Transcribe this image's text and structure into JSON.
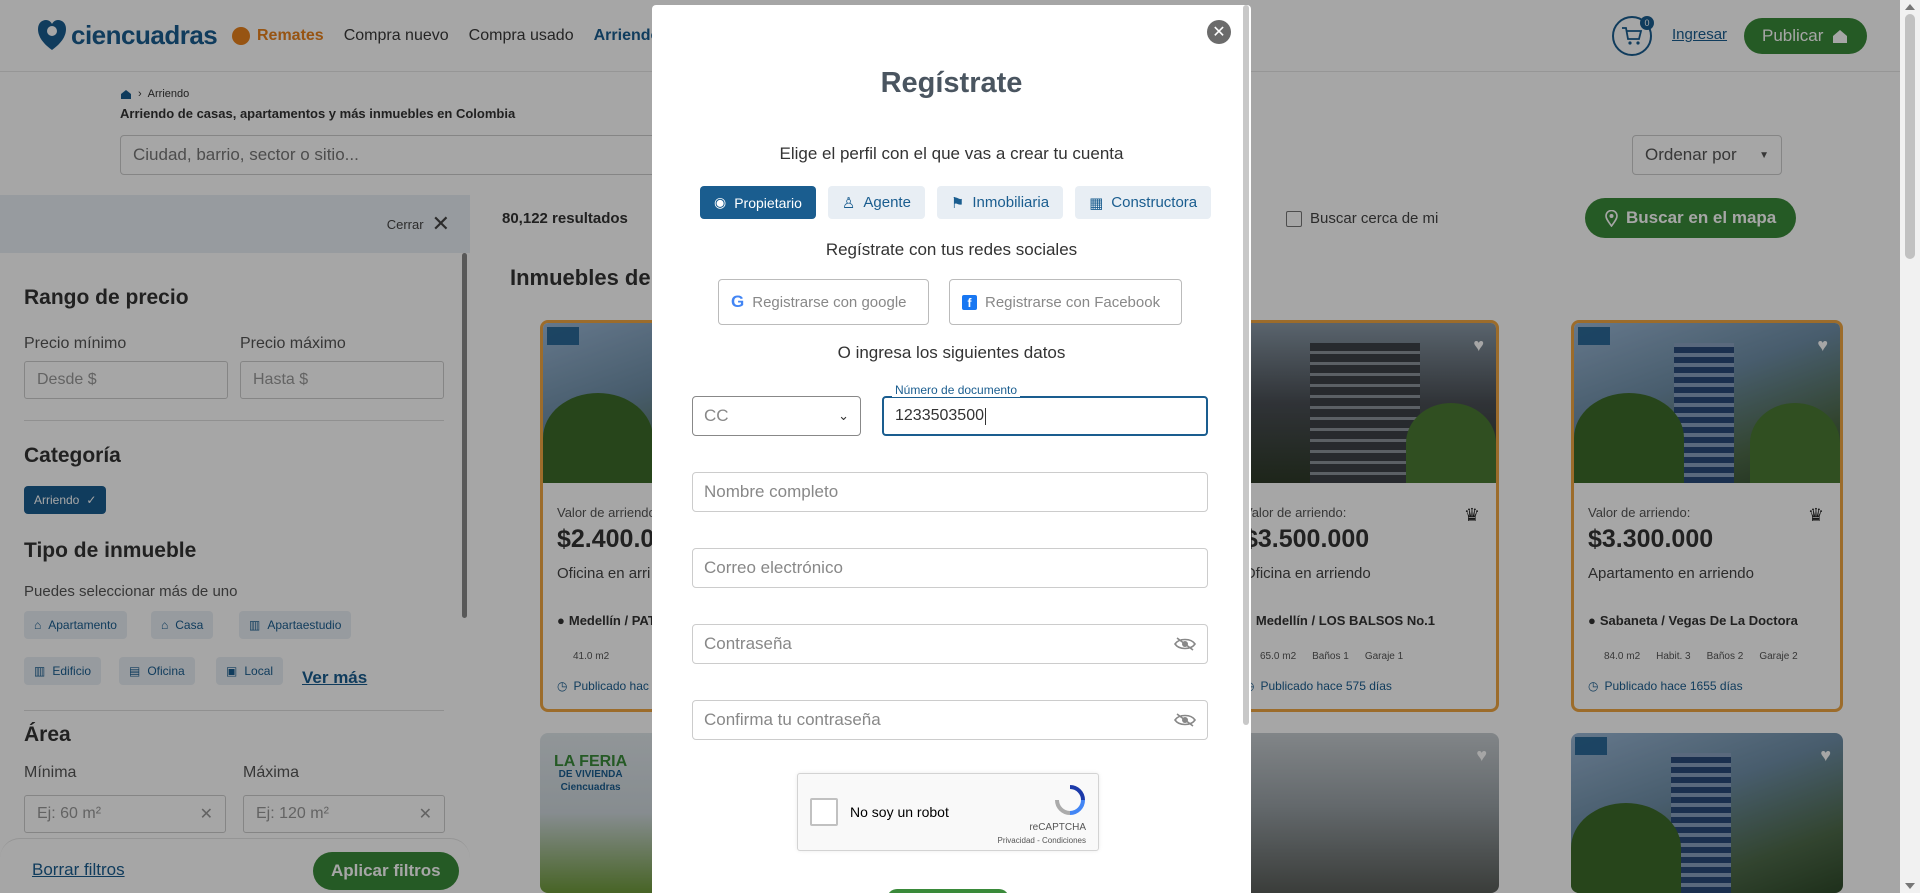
{
  "header": {
    "logo": "ciencuadras",
    "nav": [
      "Remates",
      "Compra nuevo",
      "Compra usado",
      "Arriendo"
    ],
    "cart_count": "0",
    "login": "Ingresar",
    "publish": "Publicar"
  },
  "page": {
    "breadcrumb": "Arriendo",
    "subtitle": "Arriendo de casas, apartamentos y más inmuebles en Colombia",
    "search_placeholder": "Ciudad, barrio, sector o sitio...",
    "order_by": "Ordenar por",
    "results": "80,122 resultados",
    "near_me": "Buscar cerca de mi",
    "map_button": "Buscar en el mapa",
    "section_title": "Inmuebles de"
  },
  "sidebar": {
    "close": "Cerrar",
    "price_title": "Rango de precio",
    "min_label": "Precio mínimo",
    "max_label": "Precio máximo",
    "min_placeholder": "Desde $",
    "max_placeholder": "Hasta $",
    "category_title": "Categoría",
    "category_selected": "Arriendo",
    "type_title": "Tipo de inmueble",
    "type_hint": "Puedes seleccionar más de uno",
    "types": [
      "Apartamento",
      "Casa",
      "Apartaestudio",
      "Edificio",
      "Oficina",
      "Local"
    ],
    "see_more": "Ver más",
    "area_title": "Área",
    "area_min_label": "Mínima",
    "area_max_label": "Máxima",
    "area_min_placeholder": "Ej: 60 m²",
    "area_max_placeholder": "Ej: 120 m²",
    "clear": "Borrar filtros",
    "apply": "Aplicar filtros"
  },
  "cards": [
    {
      "label": "Valor de arriendo",
      "price": "$2.400.0",
      "type": "Oficina en arri",
      "location": "Medellín / PAT",
      "features": [
        "41.0 m2"
      ],
      "published": "Publicado hac"
    },
    {
      "label": "Valor de arriendo:",
      "price": "$3.500.000",
      "type": "Oficina en arriendo",
      "location": "Medellín / LOS BALSOS No.1",
      "features": [
        "65.0 m2",
        "Baños 1",
        "Garaje 1"
      ],
      "published": "Publicado hace 575 días"
    },
    {
      "label": "Valor de arriendo:",
      "price": "$3.300.000",
      "type": "Apartamento en arriendo",
      "location": "Sabaneta / Vegas De La Doctora",
      "features": [
        "84.0 m2",
        "Habit. 3",
        "Baños 2",
        "Garaje 2"
      ],
      "published": "Publicado hace 1655 días"
    }
  ],
  "banner_text": [
    "LA FERIA",
    "DE VIVIENDA",
    "Ciencuadras"
  ],
  "modal": {
    "title": "Regístrate",
    "profile_prompt": "Elige el perfil con el que vas a crear tu cuenta",
    "profiles": [
      "Propietario",
      "Agente",
      "Inmobiliaria",
      "Constructora"
    ],
    "social_prompt": "Regístrate con tus redes sociales",
    "google": "Registrarse con google",
    "facebook": "Registrarse con Facebook",
    "or_prompt": "O ingresa los siguientes datos",
    "doc_type": "CC",
    "doc_label": "Número de documento",
    "doc_value": "1233503500",
    "name_placeholder": "Nombre completo",
    "email_placeholder": "Correo electrónico",
    "password_placeholder": "Contraseña",
    "confirm_placeholder": "Confirma tu contraseña",
    "captcha_text": "No soy un robot",
    "captcha_brand": "reCAPTCHA",
    "captcha_links": "Privacidad - Condiciones"
  },
  "colors": {
    "brand_blue": "#1a5d8f",
    "green": "#3a8a3a",
    "orange": "#e8811c",
    "card_border": "#f0a742"
  }
}
